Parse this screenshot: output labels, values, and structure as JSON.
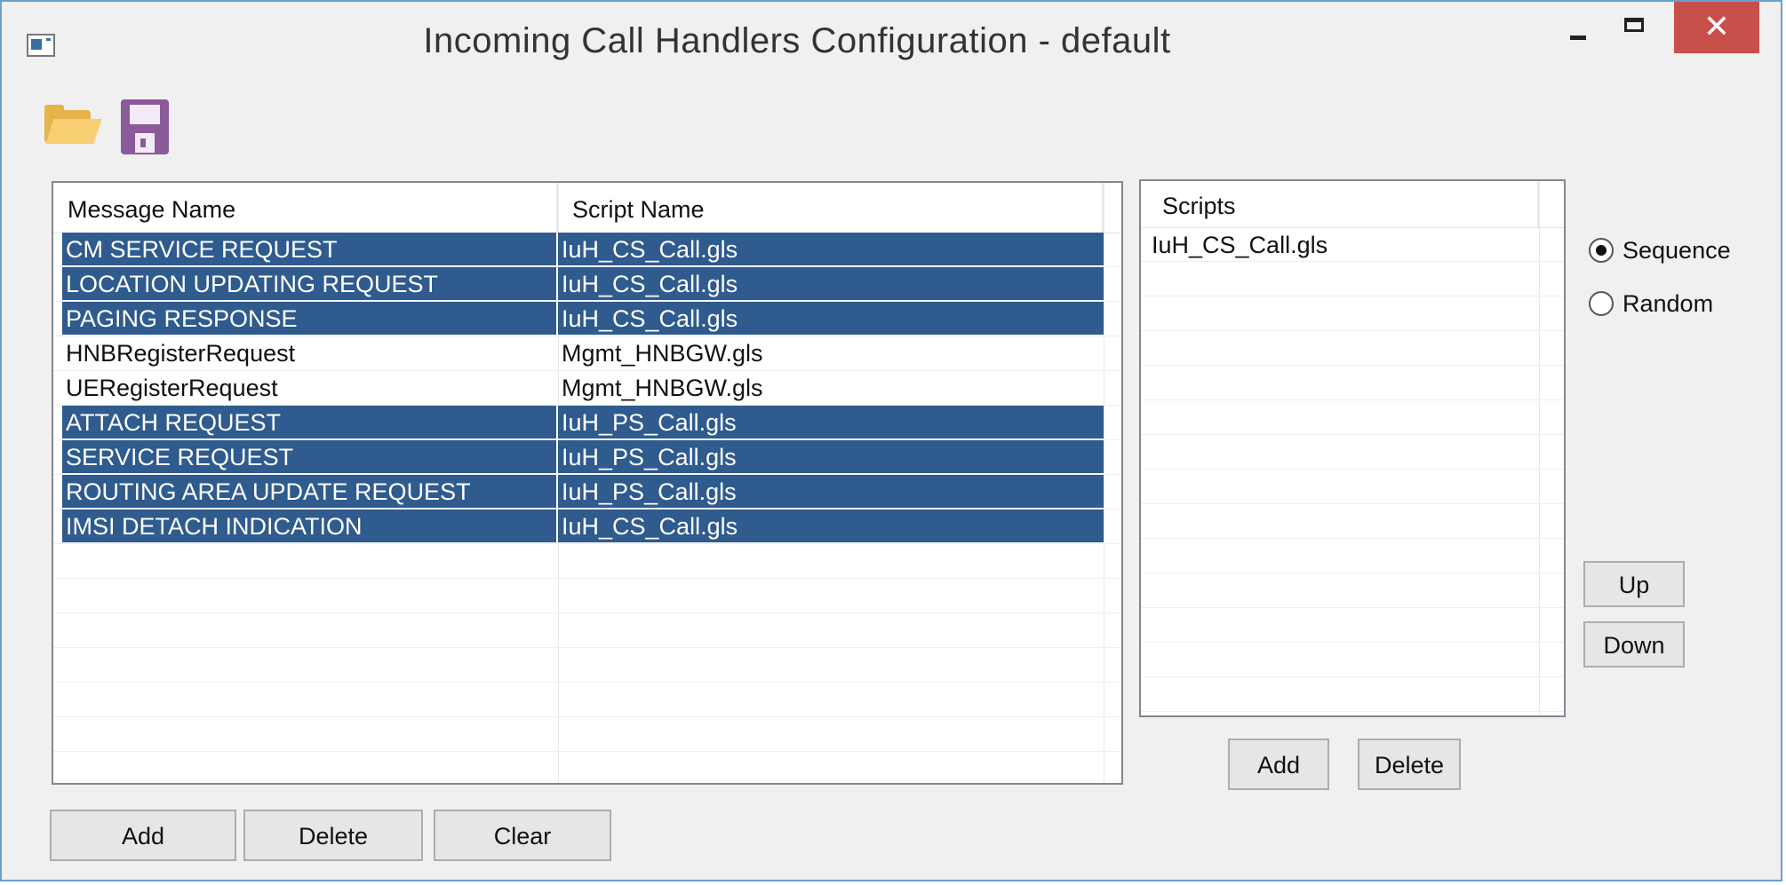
{
  "window": {
    "title": "Incoming Call Handlers Configuration - default",
    "close_label": "✕"
  },
  "toolbar": {
    "open_icon": "folder-open-icon",
    "save_icon": "floppy-disk-icon"
  },
  "handlers_table": {
    "columns": [
      "Message Name",
      "Script Name"
    ],
    "rows": [
      {
        "message": "CM SERVICE REQUEST",
        "script": "IuH_CS_Call.gls",
        "selected": true
      },
      {
        "message": "LOCATION UPDATING REQUEST",
        "script": "IuH_CS_Call.gls",
        "selected": true
      },
      {
        "message": "PAGING RESPONSE",
        "script": "IuH_CS_Call.gls",
        "selected": true
      },
      {
        "message": "HNBRegisterRequest",
        "script": "Mgmt_HNBGW.gls",
        "selected": false
      },
      {
        "message": "UERegisterRequest",
        "script": "Mgmt_HNBGW.gls",
        "selected": false
      },
      {
        "message": "ATTACH REQUEST",
        "script": "IuH_PS_Call.gls",
        "selected": true
      },
      {
        "message": "SERVICE REQUEST",
        "script": "IuH_PS_Call.gls",
        "selected": true
      },
      {
        "message": "ROUTING AREA UPDATE REQUEST",
        "script": "IuH_PS_Call.gls",
        "selected": true
      },
      {
        "message": "IMSI DETACH INDICATION",
        "script": "IuH_CS_Call.gls",
        "selected": true
      }
    ],
    "add_label": "Add",
    "delete_label": "Delete",
    "clear_label": "Clear"
  },
  "scripts_list": {
    "header": "Scripts",
    "items": [
      "IuH_CS_Call.gls"
    ],
    "add_label": "Add",
    "delete_label": "Delete"
  },
  "order_mode": {
    "options": [
      "Sequence",
      "Random"
    ],
    "selected": "Sequence",
    "up_label": "Up",
    "down_label": "Down"
  },
  "colors": {
    "selection": "#2f5b8e",
    "close_button": "#c7504b",
    "window_border": "#6a9fcf"
  }
}
